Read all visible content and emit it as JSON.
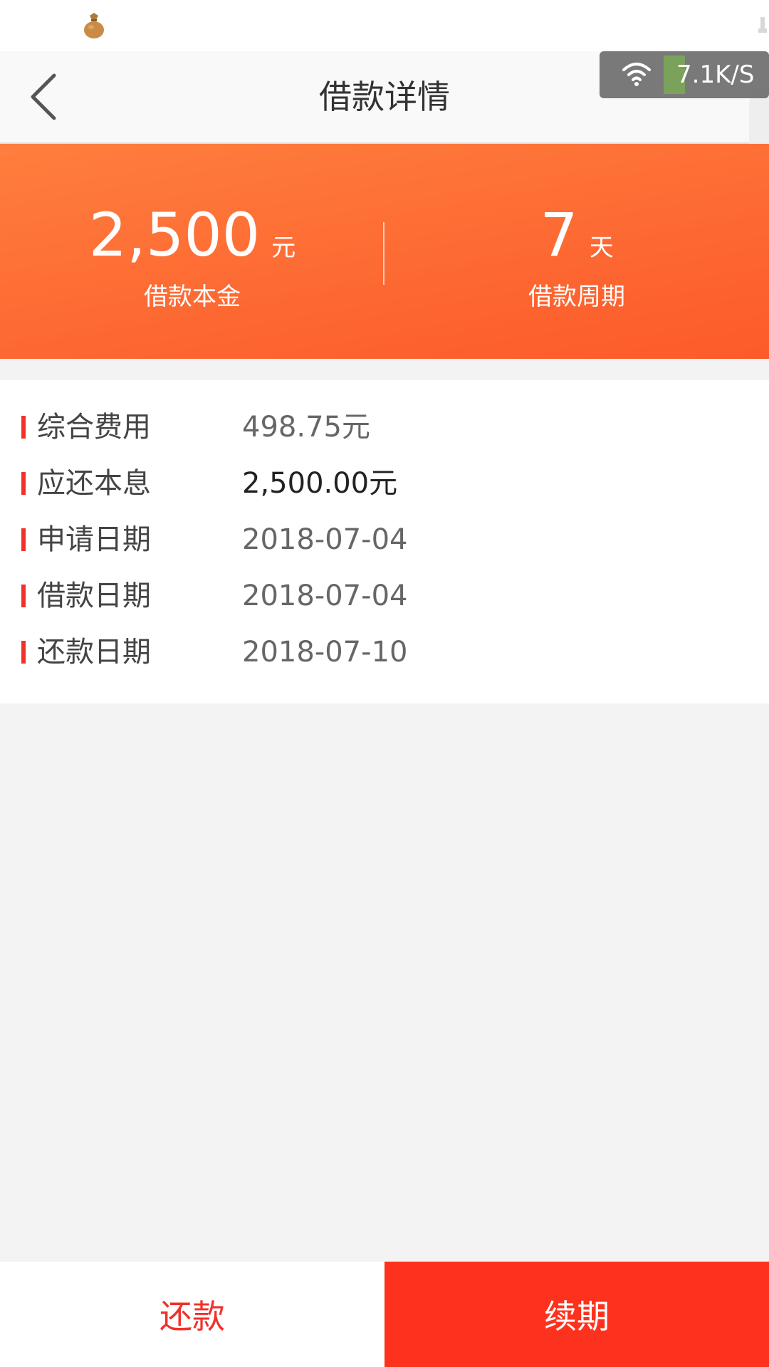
{
  "status_bar": {
    "app_icon": "money-bag-icon"
  },
  "network_overlay": {
    "icon": "wifi-icon",
    "speed": "7.1K/S"
  },
  "header": {
    "back_icon": "chevron-left-icon",
    "title": "借款详情"
  },
  "summary": {
    "principal": {
      "value": "2,500",
      "unit": "元",
      "label": "借款本金"
    },
    "term": {
      "value": "7",
      "unit": "天",
      "label": "借款周期"
    }
  },
  "details": [
    {
      "label": "综合费用",
      "value": "498.75元"
    },
    {
      "label": "应还本息",
      "value": "2,500.00元"
    },
    {
      "label": "申请日期",
      "value": "2018-07-04"
    },
    {
      "label": "借款日期",
      "value": "2018-07-04"
    },
    {
      "label": "还款日期",
      "value": "2018-07-10"
    }
  ],
  "actions": {
    "repay_label": "还款",
    "renew_label": "续期"
  },
  "colors": {
    "accent": "#f0322a",
    "banner_top": "#ff7e3e",
    "banner_bottom": "#fd5a2a",
    "renew_button": "#fd321e"
  }
}
